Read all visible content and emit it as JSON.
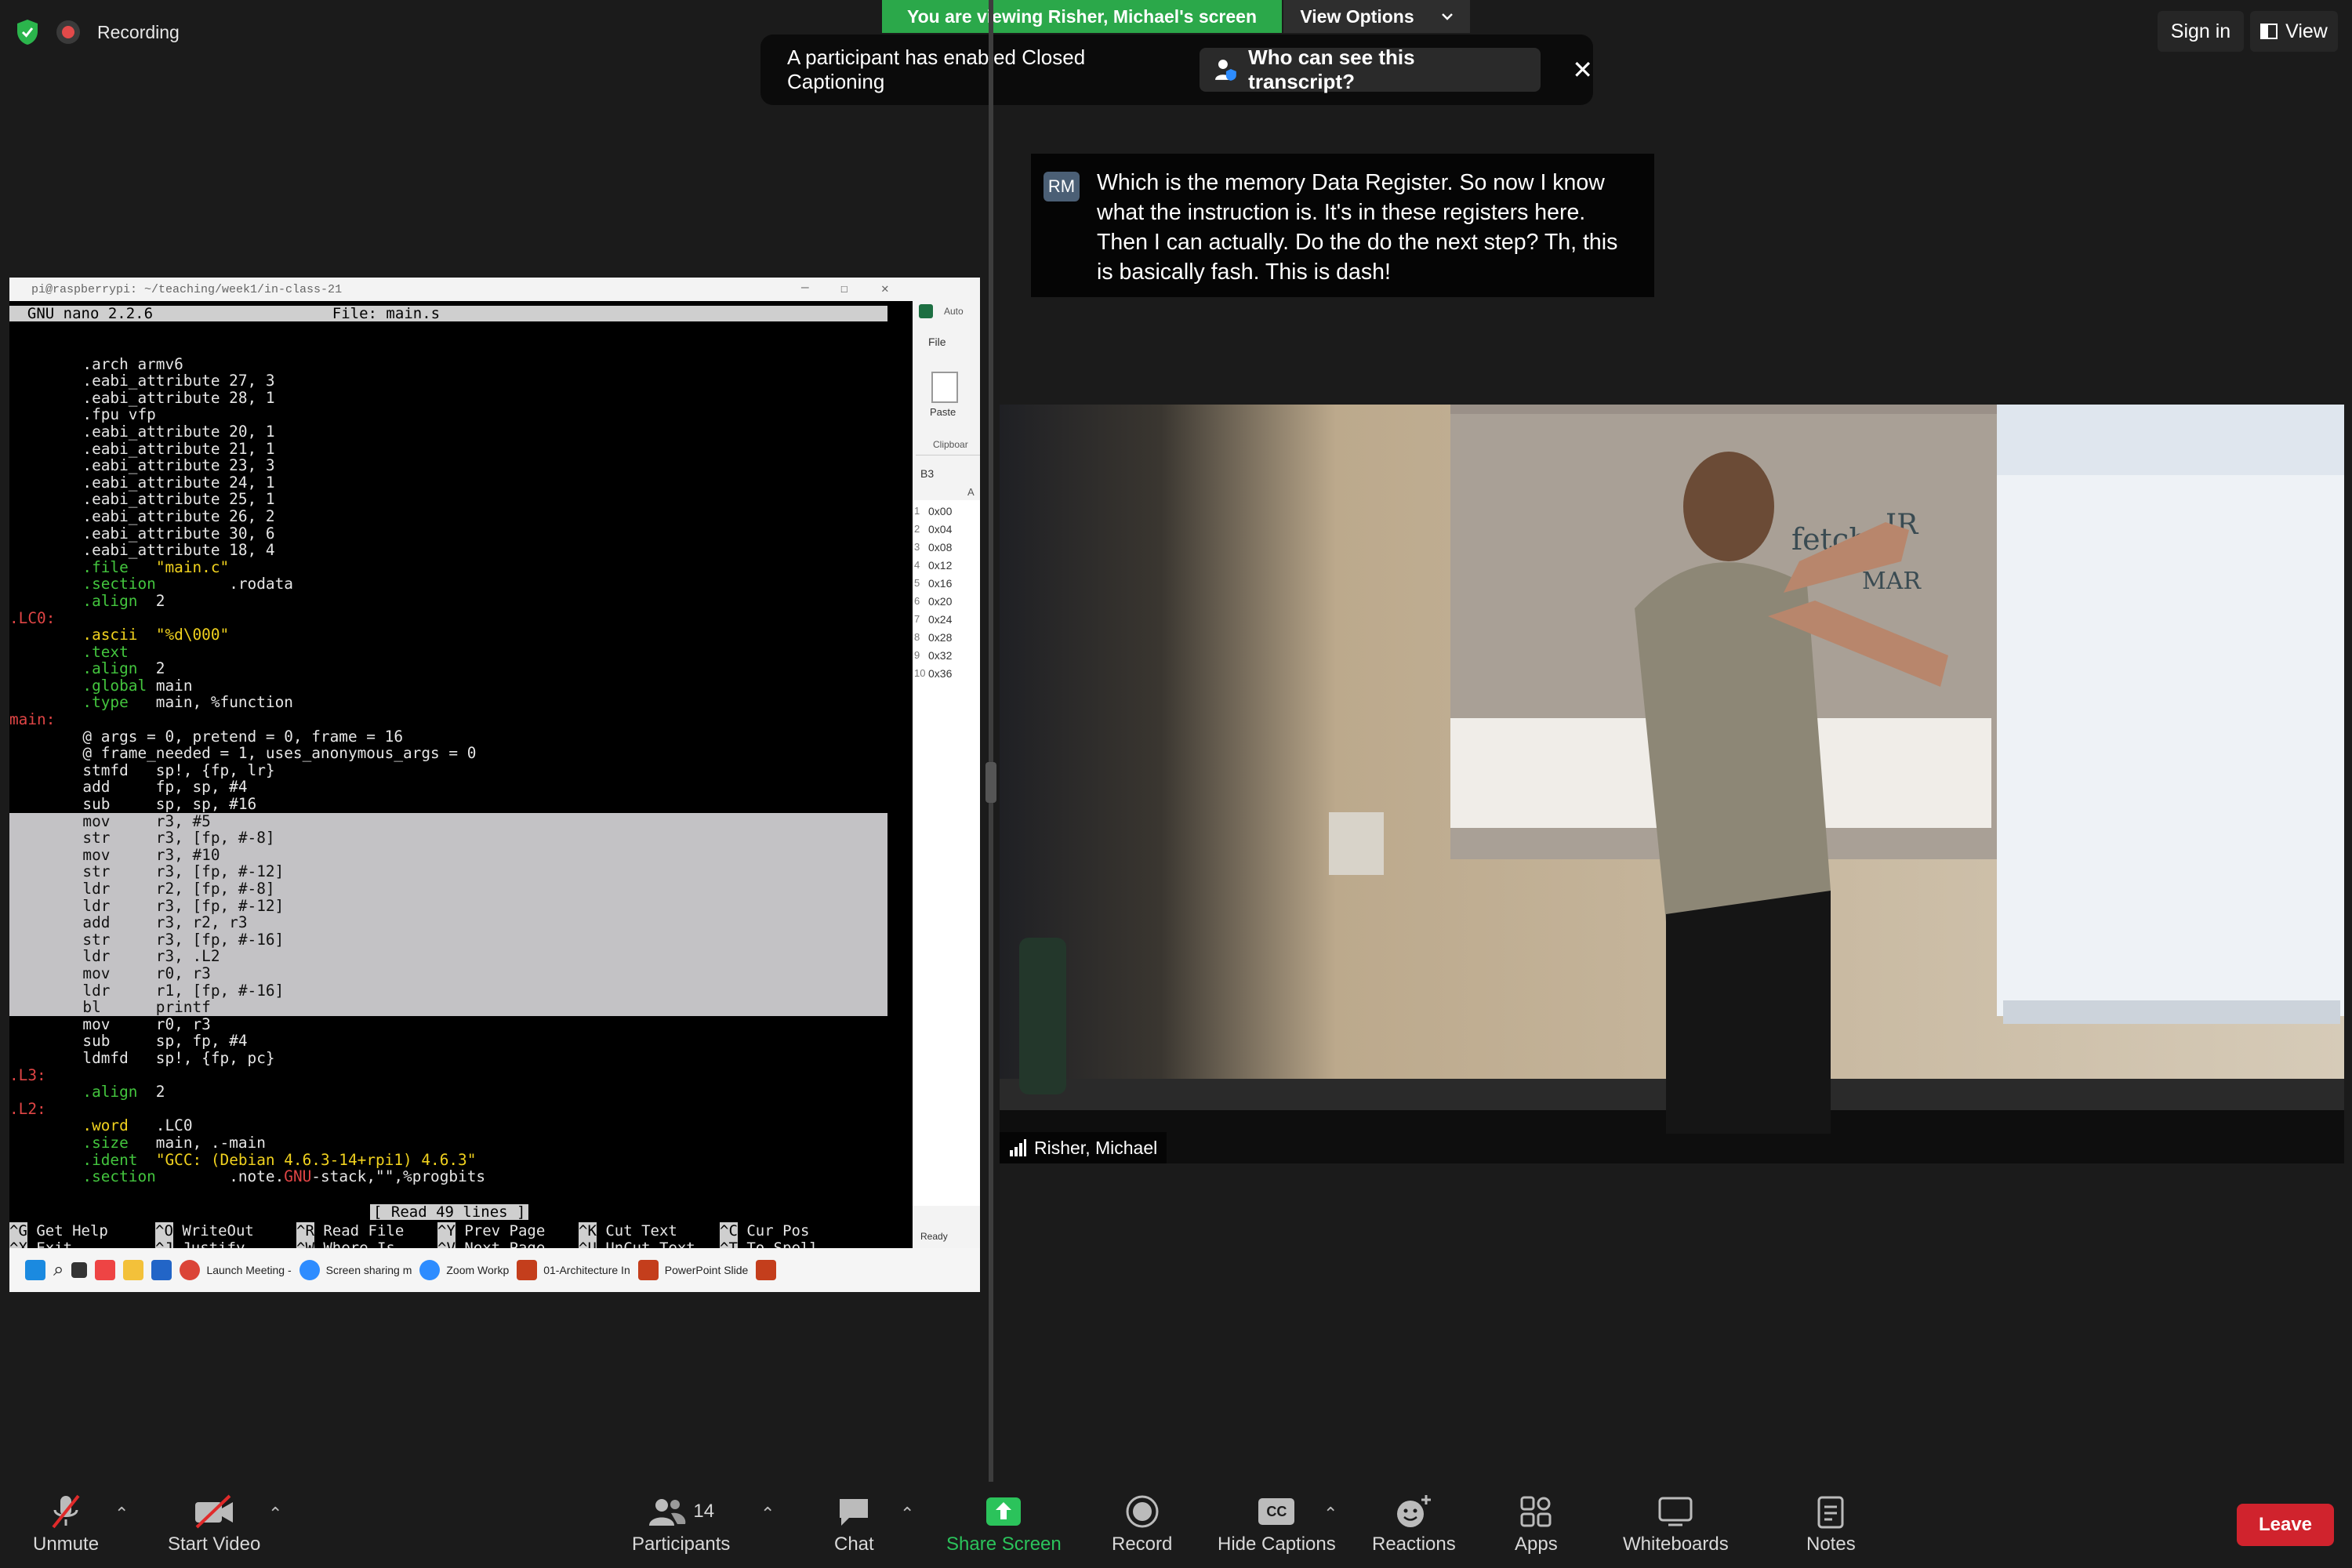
{
  "topbar": {
    "recording_label": "Recording",
    "viewing_banner": "You are viewing Risher, Michael's screen",
    "view_options": "View Options",
    "sign_in": "Sign in",
    "view": "View"
  },
  "cc_banner": {
    "message": "A participant has enabled Closed Captioning",
    "button": "Who can see this transcript?",
    "close": "✕"
  },
  "caption": {
    "initials": "RM",
    "text": "Which is the memory Data Register. So now I know what the instruction is. It's in these registers here. Then I can actually. Do the do the next step? Th, this is basically fash. This is dash!"
  },
  "shared_window": {
    "title": "pi@raspberrypi: ~/teaching/week1/in-class-21",
    "nano_header": "  GNU nano 2.2.6                    File: main.s",
    "status_message": "[ Read 49 lines ]",
    "shortcuts": [
      {
        "key": "^G",
        "label": "Get Help"
      },
      {
        "key": "^O",
        "label": "WriteOut"
      },
      {
        "key": "^R",
        "label": "Read File"
      },
      {
        "key": "^Y",
        "label": "Prev Page"
      },
      {
        "key": "^K",
        "label": "Cut Text"
      },
      {
        "key": "^C",
        "label": "Cur Pos"
      },
      {
        "key": "^X",
        "label": "Exit"
      },
      {
        "key": "^J",
        "label": "Justify"
      },
      {
        "key": "^W",
        "label": "Where Is"
      },
      {
        "key": "^V",
        "label": "Next Page"
      },
      {
        "key": "^U",
        "label": "UnCut Text"
      },
      {
        "key": "^T",
        "label": "To Spell"
      }
    ],
    "excel": {
      "tab": "Auto",
      "file": "File",
      "paste": "Paste",
      "clipboard": "Clipboar",
      "cell": "B3",
      "col": "A",
      "rows": [
        "0x00",
        "0x04",
        "0x08",
        "0x12",
        "0x16",
        "0x20",
        "0x24",
        "0x28",
        "0x32",
        "0x36"
      ],
      "status": "Ready"
    }
  },
  "taskbar": {
    "items": [
      "Launch Meeting -",
      "Screen sharing m",
      "Zoom Workp",
      "01-Architecture In",
      "PowerPoint Slide"
    ]
  },
  "video": {
    "participant_name": "Risher, Michael"
  },
  "toolbar": {
    "unmute": "Unmute",
    "start_video": "Start Video",
    "participants": "Participants",
    "participants_count": "14",
    "chat": "Chat",
    "share_screen": "Share Screen",
    "record": "Record",
    "hide_captions": "Hide Captions",
    "cc_badge": "CC",
    "reactions": "Reactions",
    "apps": "Apps",
    "whiteboards": "Whiteboards",
    "notes": "Notes",
    "leave": "Leave"
  },
  "colors": {
    "viewing_green": "#2ba84a",
    "leave_red": "#d0232d",
    "share_green": "#2bc35b",
    "code_green": "#43c53e",
    "code_yellow": "#f1d21e",
    "code_red": "#e04545"
  }
}
